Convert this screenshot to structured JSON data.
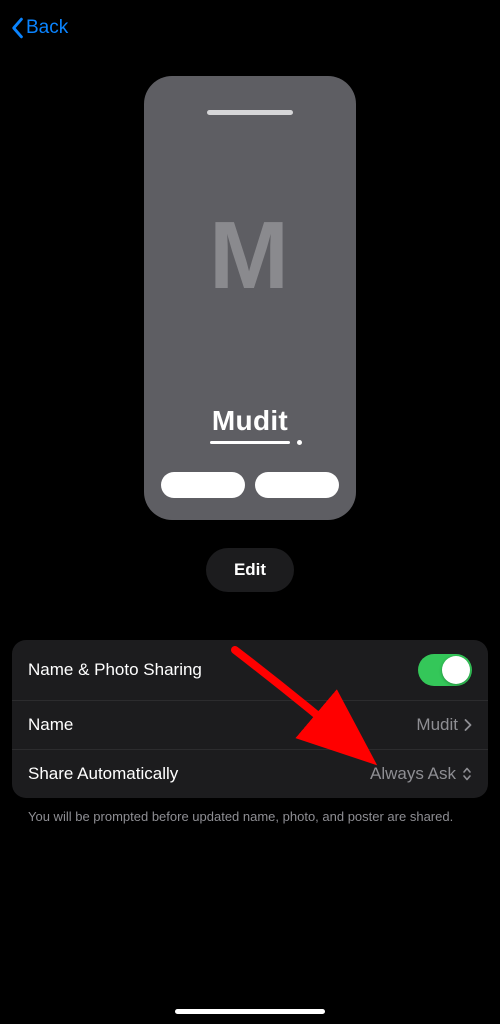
{
  "nav": {
    "back_label": "Back"
  },
  "poster": {
    "monogram": "M",
    "name": "Mudit"
  },
  "edit_label": "Edit",
  "settings": {
    "sharing_label": "Name & Photo Sharing",
    "sharing_enabled": true,
    "name_label": "Name",
    "name_value": "Mudit",
    "share_auto_label": "Share Automatically",
    "share_auto_value": "Always Ask"
  },
  "footer": "You will be prompted before updated name, photo, and poster are shared.",
  "colors": {
    "accent_blue": "#0a84ff",
    "toggle_green": "#34c759",
    "annotation_red": "#ff0000"
  }
}
